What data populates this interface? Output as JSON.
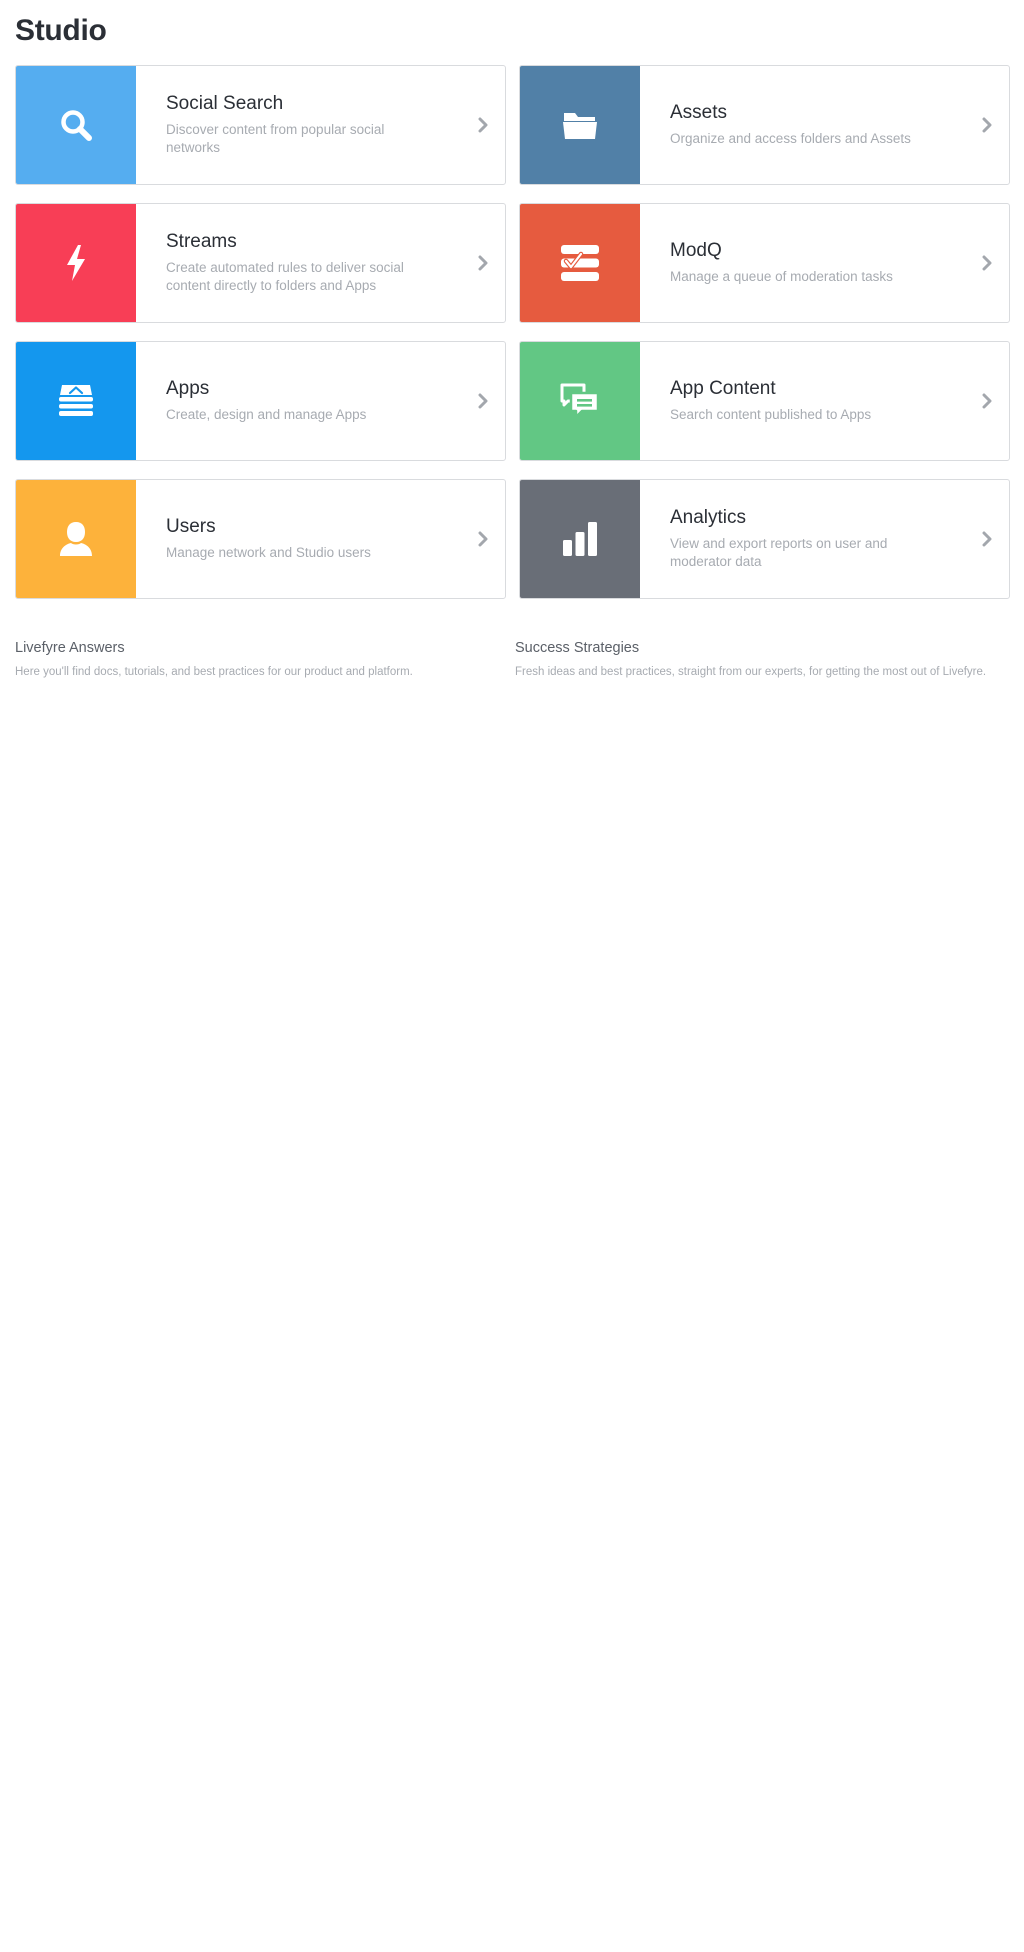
{
  "page": {
    "title": "Studio"
  },
  "cards": [
    {
      "title": "Social Search",
      "description": "Discover content from popular social networks",
      "icon": "search-icon",
      "color": "#55adf0"
    },
    {
      "title": "Assets",
      "description": "Organize and access folders and Assets",
      "icon": "folder-icon",
      "color": "#5180a7"
    },
    {
      "title": "Streams",
      "description": "Create automated rules to deliver social content directly to folders and Apps",
      "icon": "lightning-icon",
      "color": "#f83e56"
    },
    {
      "title": "ModQ",
      "description": "Manage a queue of moderation tasks",
      "icon": "checklist-icon",
      "color": "#e65b3f"
    },
    {
      "title": "Apps",
      "description": "Create, design and manage Apps",
      "icon": "app-stack-icon",
      "color": "#1497ee"
    },
    {
      "title": "App Content",
      "description": "Search content published to Apps",
      "icon": "chat-bubbles-icon",
      "color": "#62c784"
    },
    {
      "title": "Users",
      "description": "Manage network and Studio users",
      "icon": "user-icon",
      "color": "#fdb23b"
    },
    {
      "title": "Analytics",
      "description": "View and export reports on user and moderator data",
      "icon": "bar-chart-icon",
      "color": "#696e77"
    }
  ],
  "chevron_icon": "chevron-right-icon",
  "resources": [
    {
      "title": "Livefyre Answers",
      "description": "Here you'll find docs, tutorials, and best practices for our product and platform."
    },
    {
      "title": "Success Strategies",
      "description": "Fresh ideas and best practices, straight from our experts, for getting the most out of Livefyre."
    }
  ]
}
